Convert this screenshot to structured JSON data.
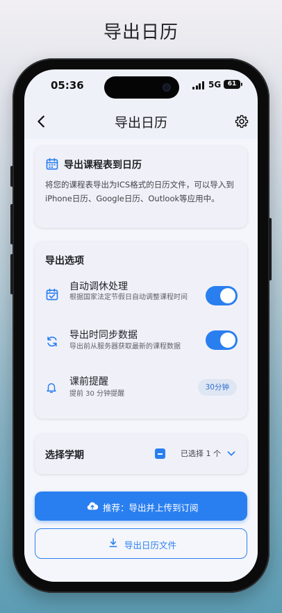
{
  "poster_title": "导出日历",
  "status_bar": {
    "time": "05:36",
    "network": "5G",
    "battery": "61"
  },
  "navbar": {
    "title": "导出日历",
    "back_icon": "chevron-left-icon",
    "settings_icon": "gear-icon"
  },
  "intro_card": {
    "icon": "calendar-icon",
    "title": "导出课程表到日历",
    "description": "将您的课程表导出为ICS格式的日历文件，可以导入到iPhone日历、Google日历、Outlook等应用中。"
  },
  "export_options": {
    "title": "导出选项",
    "items": [
      {
        "icon": "calendar-check-icon",
        "label": "自动调休处理",
        "subtitle": "根据国家法定节假日自动调整课程时间",
        "enabled": true
      },
      {
        "icon": "sync-icon",
        "label": "导出时同步数据",
        "subtitle": "导出前从服务器获取最新的课程数据",
        "enabled": true
      },
      {
        "icon": "bell-icon",
        "label": "课前提醒",
        "subtitle": "提前 30 分钟提醒",
        "badge": "30分钟"
      }
    ]
  },
  "semester": {
    "title": "选择学期",
    "selected_text": "已选择 1 个",
    "checkbox_state": "indeterminate"
  },
  "buttons": {
    "primary": {
      "icon": "cloud-upload-icon",
      "label": "推荐：导出并上传到订阅"
    },
    "secondary": {
      "icon": "download-icon",
      "label": "导出日历文件"
    }
  },
  "colors": {
    "accent": "#2a7ff0",
    "badge_bg": "#dfe6f3",
    "badge_text": "#2a6fce"
  }
}
